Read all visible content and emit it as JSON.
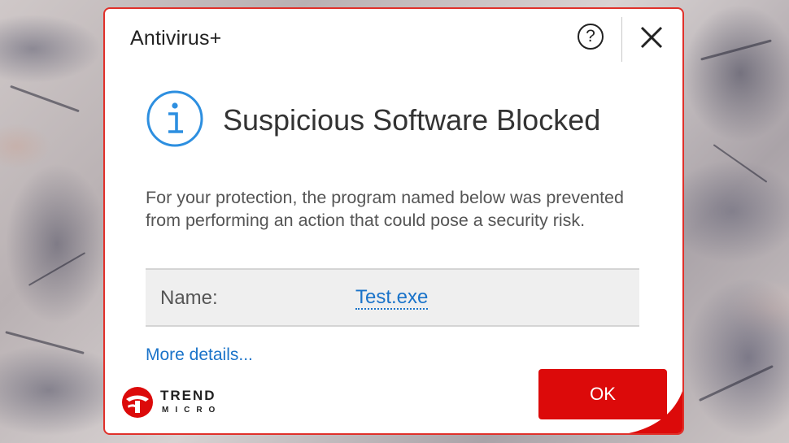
{
  "dialog": {
    "brand_title": "Antivirus+",
    "help_glyph": "?",
    "headline": "Suspicious Software Blocked",
    "message": "For your protection, the program named below was prevented from performing an action that could pose a security risk.",
    "name_label": "Name:",
    "name_value": "Test.exe",
    "more_details": "More details...",
    "ok_label": "OK",
    "logo_word_top": "TREND",
    "logo_word_bottom": "MICRO"
  },
  "icons": {
    "help": "help-circle-icon",
    "close": "close-icon",
    "info": "info-circle-icon",
    "logo": "trend-micro-logo"
  },
  "colors": {
    "accent_red": "#dc0a0a",
    "border_red": "#e0302a",
    "info_blue": "#2d8fe0",
    "link_blue": "#1a73c9",
    "name_row_bg": "#efefef"
  }
}
